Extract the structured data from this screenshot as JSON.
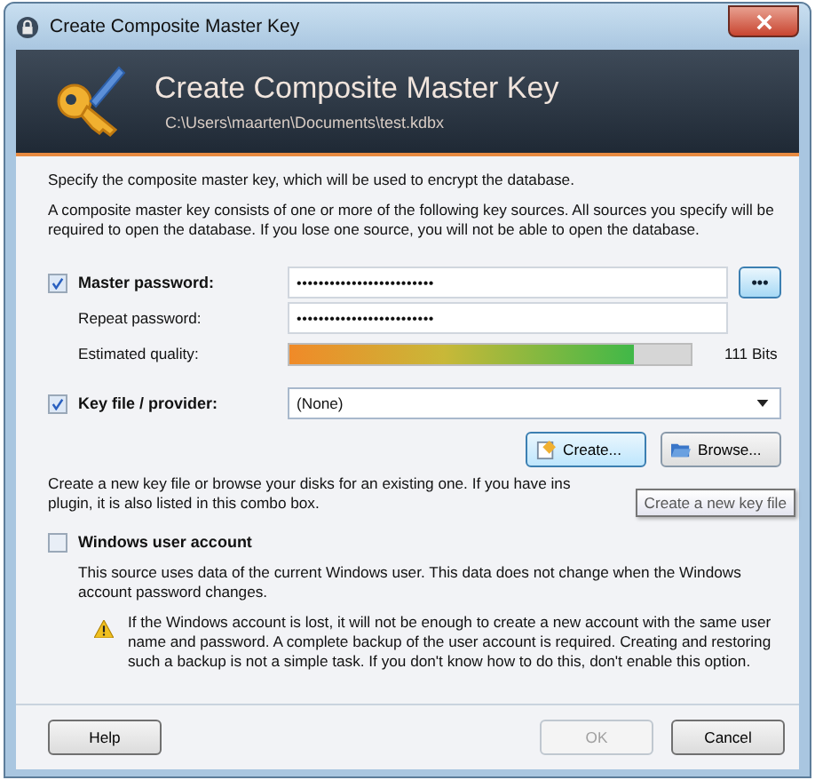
{
  "window": {
    "title": "Create Composite Master Key"
  },
  "header": {
    "title": "Create Composite Master Key",
    "path": "C:\\Users\\maarten\\Documents\\test.kdbx"
  },
  "intro": "Specify the composite master key, which will be used to encrypt the database.",
  "description": "A composite master key consists of one or more of the following key sources. All sources you specify will be required to open the database.  If you lose one source, you will not be able to open the database.",
  "master_password": {
    "checked": true,
    "label": "Master password:",
    "value": "•••••••••••••••••••••••••",
    "show_button": "•••",
    "repeat_label": "Repeat password:",
    "repeat_value": "•••••••••••••••••••••••••",
    "quality_label": "Estimated quality:",
    "quality": {
      "level": 0.86,
      "reading": "111 Bits"
    }
  },
  "key_file": {
    "checked": true,
    "label": "Key file / provider:",
    "value": "(None)",
    "buttons": [
      {
        "label": "Create...",
        "hovered": true
      },
      {
        "label": "Browse...",
        "hovered": false
      }
    ],
    "hint_lines": [
      "Create a new key file or browse your disks for an existing one. If you have ins",
      "plugin, it is also listed in this combo box."
    ],
    "tooltip": "Create a new key file"
  },
  "windows_account": {
    "checked": false,
    "label": "Windows user account",
    "description": "This source uses data of the current Windows user. This data does not change when the Windows account password changes.",
    "warning": "If the Windows account is lost, it will not be enough to create a new account with the same user name and password. A complete backup of the user account is required. Creating and restoring such a backup is not a simple task. If you don't know how to do this, don't enable this option."
  },
  "buttons": [
    {
      "label": "Help",
      "disabled": false
    },
    {
      "label": "OK",
      "disabled": true
    },
    {
      "label": "Cancel",
      "disabled": false
    }
  ]
}
